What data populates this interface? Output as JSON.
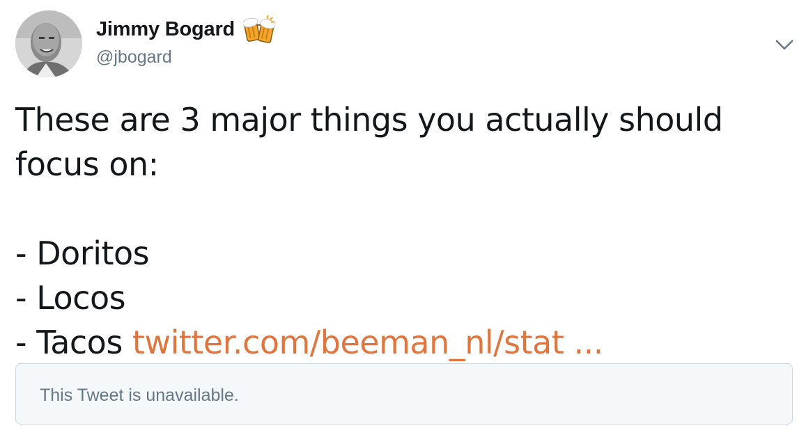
{
  "author": {
    "display_name": "Jimmy Bogard",
    "handle": "@jbogard",
    "name_emoji": "beer-mugs-icon",
    "avatar": "avatar"
  },
  "menu": {
    "icon": "chevron-down-icon"
  },
  "tweet": {
    "lines": [
      "These are 3 major things you actually should",
      "focus on:",
      "",
      "- Doritos",
      "- Locos",
      "- Tacos "
    ],
    "link_text": "twitter.com/beeman_nl/stat ..."
  },
  "quoted_tweet": {
    "message": "This Tweet is unavailable."
  },
  "colors": {
    "text": "#14171a",
    "secondary": "#657786",
    "link": "#e0763e",
    "card_bg": "#f5f8fa",
    "card_border": "#ccd6dd"
  }
}
